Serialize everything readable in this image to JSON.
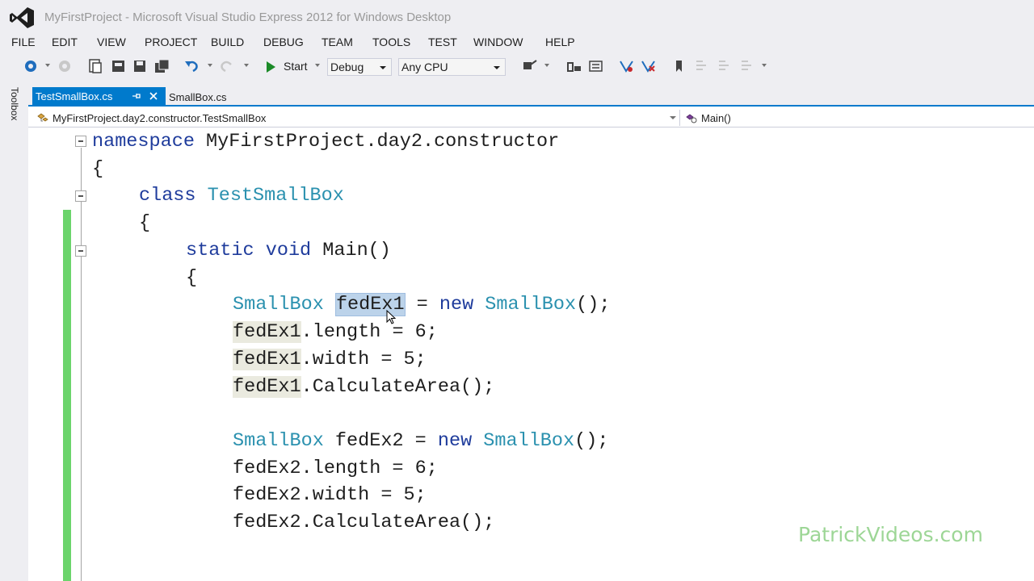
{
  "window": {
    "title": "MyFirstProject - Microsoft Visual Studio Express 2012 for Windows Desktop"
  },
  "menu": [
    "FILE",
    "EDIT",
    "VIEW",
    "PROJECT",
    "BUILD",
    "DEBUG",
    "TEAM",
    "TOOLS",
    "TEST",
    "WINDOW",
    "HELP"
  ],
  "toolbar": {
    "start_label": "Start",
    "config": "Debug",
    "platform": "Any CPU"
  },
  "toolbox": {
    "label": "Toolbox"
  },
  "tabs": {
    "active": "TestSmallBox.cs",
    "inactive": "SmallBox.cs"
  },
  "navbar": {
    "class_path": "MyFirstProject.day2.constructor.TestSmallBox",
    "member": "Main()"
  },
  "code": {
    "lines": [
      [
        "namespace",
        " MyFirstProject.day2.constructor"
      ],
      [
        "{"
      ],
      [
        "class",
        " ",
        "TestSmallBox"
      ],
      [
        "{"
      ],
      [
        "static",
        " ",
        "void",
        " Main()"
      ],
      [
        "{"
      ],
      [
        "SmallBox",
        " ",
        "fedEx1",
        " = ",
        "new",
        " ",
        "SmallBox",
        "();"
      ],
      [
        "fedEx1",
        ".length = 6;"
      ],
      [
        "fedEx1",
        ".width = 5;"
      ],
      [
        "fedEx1",
        ".CalculateArea();"
      ],
      [
        ""
      ],
      [
        "SmallBox",
        " fedEx2 = ",
        "new",
        " ",
        "SmallBox",
        "();"
      ],
      [
        "fedEx2.length = 6;"
      ],
      [
        "fedEx2.width = 5;"
      ],
      [
        "fedEx2.CalculateArea();"
      ]
    ]
  },
  "watermark": "PatrickVideos.com",
  "colors": {
    "accent": "#007acc",
    "keyword": "#1f3c9c",
    "type": "#2b91af",
    "change_bar": "#6bd46b",
    "watermark": "#9dd696"
  }
}
